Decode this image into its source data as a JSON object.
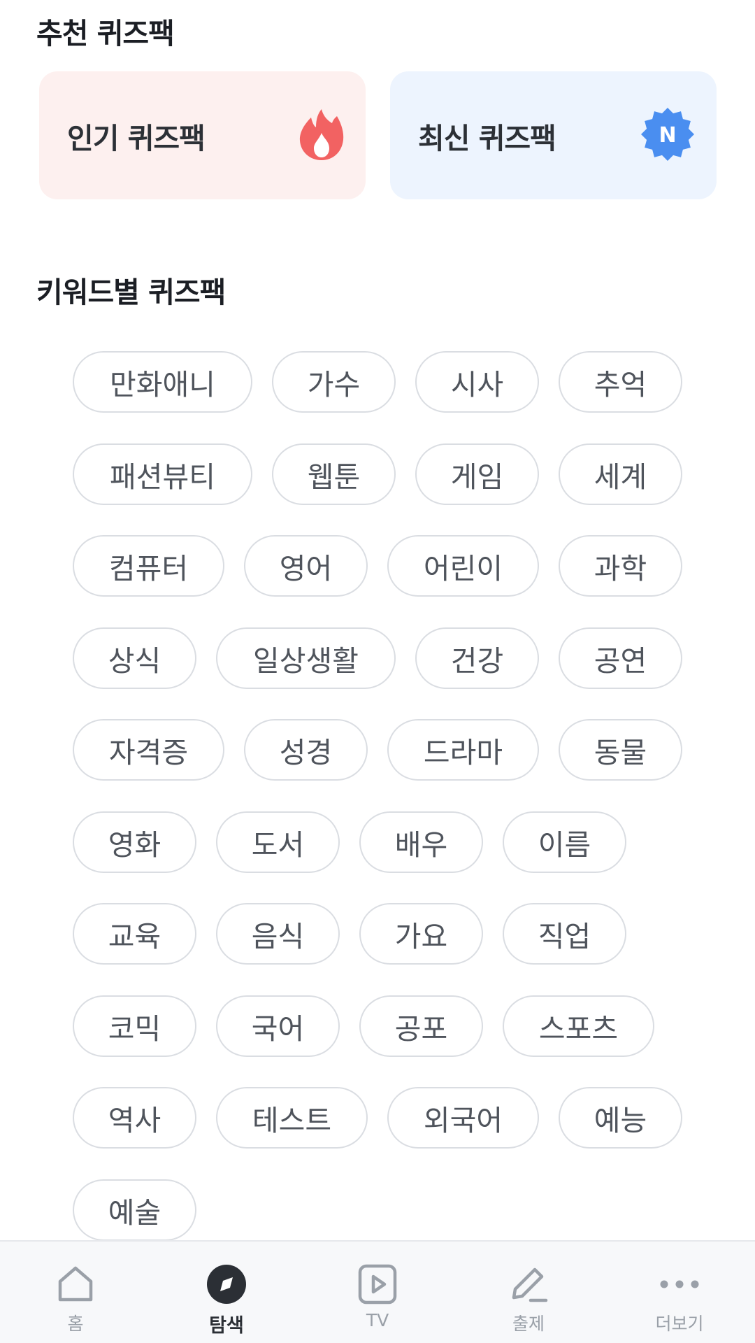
{
  "recommended": {
    "title": "추천 퀴즈팩",
    "popular_label": "인기 퀴즈팩",
    "latest_label": "최신 퀴즈팩",
    "popular_icon": "fire-icon",
    "latest_icon": "new-badge-icon",
    "latest_badge_letter": "N",
    "popular_color": "#f26262",
    "latest_color": "#4a8ef0"
  },
  "keywords": {
    "title": "키워드별 퀴즈팩",
    "rows": [
      [
        "만화애니",
        "가수",
        "시사",
        "추억"
      ],
      [
        "패션뷰티",
        "웹툰",
        "게임",
        "세계"
      ],
      [
        "컴퓨터",
        "영어",
        "어린이",
        "과학"
      ],
      [
        "상식",
        "일상생활",
        "건강",
        "공연"
      ],
      [
        "자격증",
        "성경",
        "드라마",
        "동물"
      ],
      [
        "영화",
        "도서",
        "배우",
        "이름"
      ],
      [
        "교육",
        "음식",
        "가요",
        "직업"
      ],
      [
        "코믹",
        "국어",
        "공포",
        "스포츠"
      ],
      [
        "역사",
        "테스트",
        "외국어",
        "예능"
      ],
      [
        "예술"
      ]
    ]
  },
  "nav": {
    "items": [
      {
        "label": "홈",
        "icon": "home-icon"
      },
      {
        "label": "탐색",
        "icon": "compass-icon",
        "active": true
      },
      {
        "label": "TV",
        "icon": "play-icon"
      },
      {
        "label": "출제",
        "icon": "pencil-icon"
      },
      {
        "label": "더보기",
        "icon": "more-icon"
      }
    ]
  }
}
